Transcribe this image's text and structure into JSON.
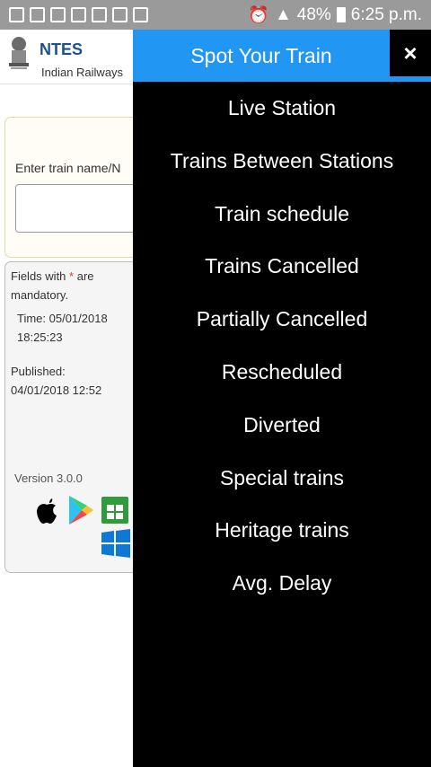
{
  "status_bar": {
    "battery": "48%",
    "time": "6:25 p.m."
  },
  "header": {
    "brand": "NTES",
    "subtitle": "Indian Railways"
  },
  "search_card": {
    "label": "Enter train name/N"
  },
  "info_card": {
    "fields_prefix": "Fields with",
    "required_mark": "*",
    "fields_suffix": "are",
    "fields_line2": "mandatory.",
    "time_label": "Time: 05/01/2018",
    "time_value": "18:25:23",
    "published_label": "Published:",
    "published_value": "04/01/2018 12:52",
    "version": "Version 3.0.0"
  },
  "drawer": {
    "title": "Spot Your Train",
    "close": "×",
    "items": [
      "Live Station",
      "Trains Between Stations",
      "Train schedule",
      "Trains Cancelled",
      "Partially Cancelled",
      "Rescheduled",
      "Diverted",
      "Special trains",
      "Heritage trains",
      "Avg. Delay"
    ]
  },
  "colors": {
    "accent": "#2196f3",
    "brand": "#1b4f9c",
    "drawer_bg": "#000000"
  },
  "icons": [
    "apple-icon",
    "google-play-icon",
    "windows-store-icon",
    "windows-logo-icon",
    "close-icon"
  ]
}
